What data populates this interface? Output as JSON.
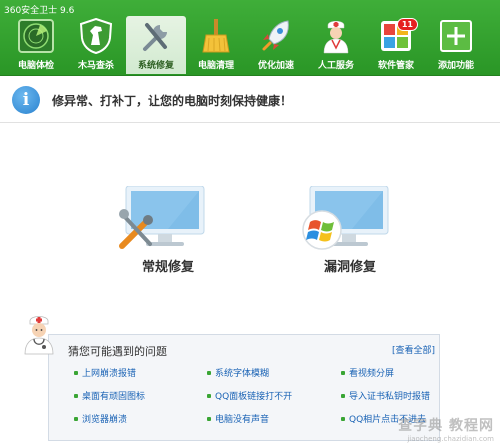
{
  "app": {
    "title": "360安全卫士 9.6"
  },
  "toolbar": {
    "items": [
      {
        "label": "电脑体检",
        "icon": "radar-icon"
      },
      {
        "label": "木马查杀",
        "icon": "horse-shield-icon"
      },
      {
        "label": "系统修复",
        "icon": "wrench-icon",
        "active": true
      },
      {
        "label": "电脑清理",
        "icon": "broom-icon"
      },
      {
        "label": "优化加速",
        "icon": "rocket-icon"
      },
      {
        "label": "人工服务",
        "icon": "doctor-icon"
      },
      {
        "label": "软件管家",
        "icon": "app-grid-icon",
        "badge": "11"
      },
      {
        "label": "添加功能",
        "icon": "plus-icon"
      }
    ]
  },
  "info": {
    "message": "修异常、打补丁，让您的电脑时刻保持健康！"
  },
  "options": {
    "regular": {
      "label": "常规修复",
      "icon": "monitor-tools-icon"
    },
    "vuln": {
      "label": "漏洞修复",
      "icon": "monitor-windows-icon"
    }
  },
  "panel": {
    "title": "猜您可能遇到的问题",
    "link": "[查看全部]",
    "questions": [
      "上网崩溃报错",
      "系统字体模糊",
      "看视频分屏",
      "桌面有顽固图标",
      "QQ面板链接打不开",
      "导入证书私钥时报错",
      "浏览器崩溃",
      "电脑没有声音",
      "QQ相片点击不进去"
    ]
  },
  "watermark": {
    "main": "查字典 教程网",
    "sub": "jiaocheng.chazidian.com"
  },
  "colors": {
    "header_green": "#3fae39",
    "link_blue": "#1a63b5",
    "bullet_green": "#39a534"
  }
}
